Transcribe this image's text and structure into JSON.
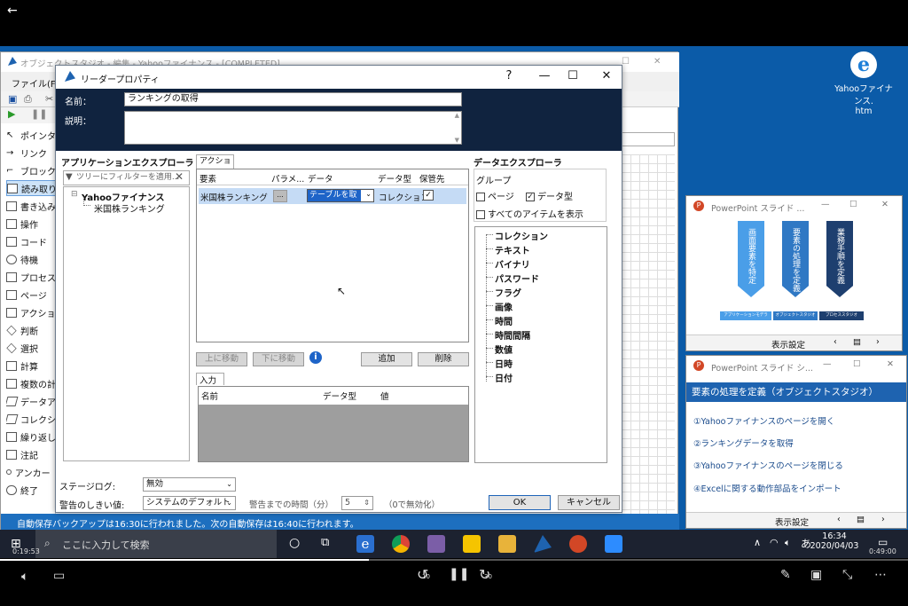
{
  "bg_window": {
    "title": "オブジェクトスタジオ - 編集 - Yahooファイナンス - [COMPLETED]",
    "menu_file": "ファイル(F)",
    "status": "自動保存バックアップは16:30に行われました。次の自動保存は16:40に行われます。",
    "palette": [
      "ポインタ",
      "リンク",
      "ブロック",
      "読み取り",
      "書き込み",
      "操作",
      "コード",
      "待機",
      "プロセス",
      "ページ",
      "アクション",
      "判断",
      "選択",
      "計算",
      "複数の計",
      "データア",
      "コレクシ",
      "繰り返し",
      "注記",
      "アンカー",
      "終了"
    ]
  },
  "dialog": {
    "title": "リーダープロパティ",
    "help": "?",
    "minimize": "—",
    "maximize": "☐",
    "close": "✕",
    "name_label": "名前：",
    "name_value": "ランキングの取得",
    "desc_label": "説明：",
    "app_explorer_title": "アプリケーションエクスプローラ",
    "filter_placeholder": "ツリーにフィルターを適用...",
    "tree_root": "Yahooファイナンス",
    "tree_child": "米国株ランキング",
    "action_tab": "アクション",
    "action_headers": [
      "要素",
      "パラメ...",
      "データ",
      "データ型",
      "保管先"
    ],
    "action_row": {
      "element": "米国株ランキング",
      "param": "...",
      "data": "テーブルを取",
      "datatype": "コレクション"
    },
    "btn_up": "上に移動",
    "btn_down": "下に移動",
    "btn_add": "追加",
    "btn_delete": "削除",
    "input_tab": "入力",
    "input_headers": [
      "名前",
      "データ型",
      "値"
    ],
    "data_explorer_title": "データエクスプローラ",
    "group_label": "グループ",
    "chk_page": "ページ",
    "chk_datatype": "データ型",
    "chk_all": "すべてのアイテムを表示",
    "data_types": [
      "コレクション",
      "テキスト",
      "バイナリ",
      "パスワード",
      "フラグ",
      "画像",
      "時間",
      "時間間隔",
      "数値",
      "日時",
      "日付"
    ],
    "stage_log_label": "ステージログ:",
    "stage_log_value": "無効",
    "warn_label": "警告のしきい値:",
    "warn_value": "システムのデフォルト",
    "warn_time_label": "警告までの時間（分）",
    "warn_time_value": "5",
    "warn_time_hint": "（0で無効化）",
    "ok": "OK",
    "cancel": "キャンセル"
  },
  "desktop_icon": {
    "label1": "Yahooファイナンス.",
    "label2": "htm"
  },
  "ppt1": {
    "title": "PowerPoint スライド ...",
    "arrows": [
      "画面要素を特定",
      "要素の処理を定義",
      "業務手順を定義"
    ],
    "boxes": [
      "アプリケーションモデラ",
      "オブジェクトスタジオ",
      "プロセススタジオ"
    ],
    "bar_label": "表示設定",
    "colors": [
      "#4a9ee8",
      "#2f78c4",
      "#1e3f6f"
    ]
  },
  "ppt2": {
    "title": "PowerPoint スライド シ...",
    "heading": "要素の処理を定義（オブジェクトスタジオ）",
    "steps": [
      "①Yahooファイナンスのページを開く",
      "②ランキングデータを取得",
      "③Yahooファイナンスのページを閉じる",
      "④Excelに関する動作部品をインポート"
    ],
    "bar_label": "表示設定"
  },
  "taskbar": {
    "search_placeholder": "ここに入力して検索",
    "time": "16:34",
    "date": "2020/04/03",
    "ime": "あ",
    "elapsed": "0:19:53",
    "total": "0:49:00"
  },
  "video": {
    "progress": 0.406,
    "skip_back": "10",
    "skip_fwd": "30"
  }
}
